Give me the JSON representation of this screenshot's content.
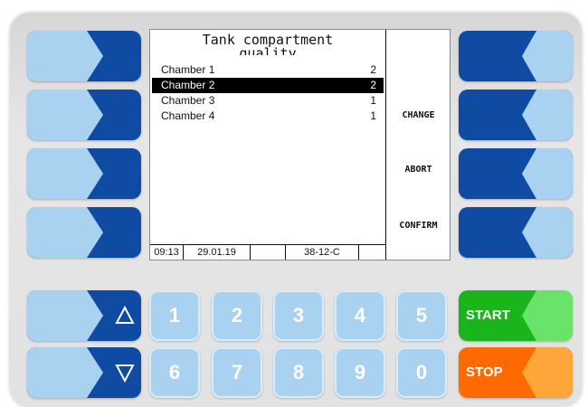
{
  "screen": {
    "title_line1": "Tank compartment",
    "title_line2": "quality",
    "rows": [
      {
        "name": "Chamber 1",
        "value": "2",
        "selected": false
      },
      {
        "name": "Chamber 2",
        "value": "2",
        "selected": true
      },
      {
        "name": "Chamber 3",
        "value": "1",
        "selected": false
      },
      {
        "name": "Chamber 4",
        "value": "1",
        "selected": false
      }
    ],
    "status": {
      "time": "09:13",
      "date": "29.01.19",
      "blank": "",
      "code": "38-12-C"
    }
  },
  "softkeys": {
    "change": "CHANGE",
    "abort": "ABORT",
    "confirm": "CONFIRM"
  },
  "keypad": {
    "up_glyph": "△",
    "down_glyph": "▽",
    "digits": [
      "1",
      "2",
      "3",
      "4",
      "5",
      "6",
      "7",
      "8",
      "9",
      "0"
    ],
    "start": "START",
    "stop": "STOP"
  },
  "colors": {
    "key_light": "#a9d2f1",
    "key_dark": "#0f4aa3",
    "start_green": "#1ab51a",
    "start_light": "#6ae36a",
    "stop_orange": "#ff6a00",
    "stop_light": "#ffa63a"
  }
}
